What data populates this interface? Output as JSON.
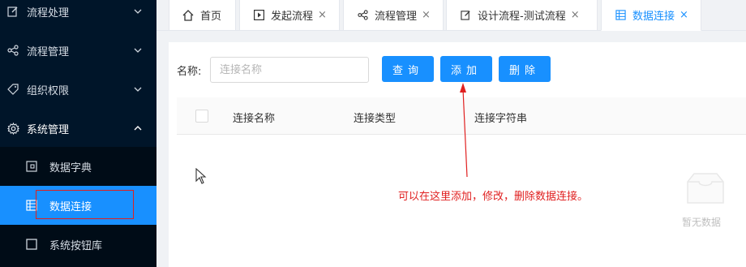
{
  "sidebar": {
    "items": [
      {
        "label": "流程处理",
        "icon": "edit-icon",
        "chevron": "chevron-down-icon"
      },
      {
        "label": "流程管理",
        "icon": "share-icon",
        "chevron": "chevron-down-icon"
      },
      {
        "label": "组织权限",
        "icon": "tag-icon",
        "chevron": "chevron-down-icon"
      },
      {
        "label": "系统管理",
        "icon": "gear-icon",
        "chevron": "chevron-up-icon"
      }
    ],
    "submenu": [
      {
        "label": "数据字典",
        "icon": "dictionary-icon"
      },
      {
        "label": "数据连接",
        "icon": "database-icon",
        "active": true
      },
      {
        "label": "系统按钮库",
        "icon": "square-icon"
      }
    ]
  },
  "tabs": [
    {
      "label": "首页",
      "icon": "home-icon",
      "closable": false
    },
    {
      "label": "发起流程",
      "icon": "play-icon",
      "closable": true,
      "close": "×"
    },
    {
      "label": "流程管理",
      "icon": "share-icon",
      "closable": true,
      "close": "×"
    },
    {
      "label": "设计流程-测试流程",
      "icon": "edit-icon",
      "closable": true,
      "close": "×"
    },
    {
      "label": "数据连接",
      "icon": "database-icon",
      "closable": true,
      "active": true,
      "close": "×"
    }
  ],
  "search": {
    "label": "名称:",
    "placeholder": "连接名称",
    "value": ""
  },
  "buttons": {
    "query": "查询",
    "add": "添加",
    "delete": "删除"
  },
  "table": {
    "columns": [
      "连接名称",
      "连接类型",
      "连接字符串"
    ],
    "rows": []
  },
  "empty": {
    "text": "暂无数据"
  },
  "annotation": {
    "text": "可以在这里添加，修改，删除数据连接。"
  },
  "colors": {
    "sidebar_bg": "#001529",
    "submenu_bg": "#000c17",
    "accent": "#1890ff",
    "annotation": "#e02020"
  }
}
